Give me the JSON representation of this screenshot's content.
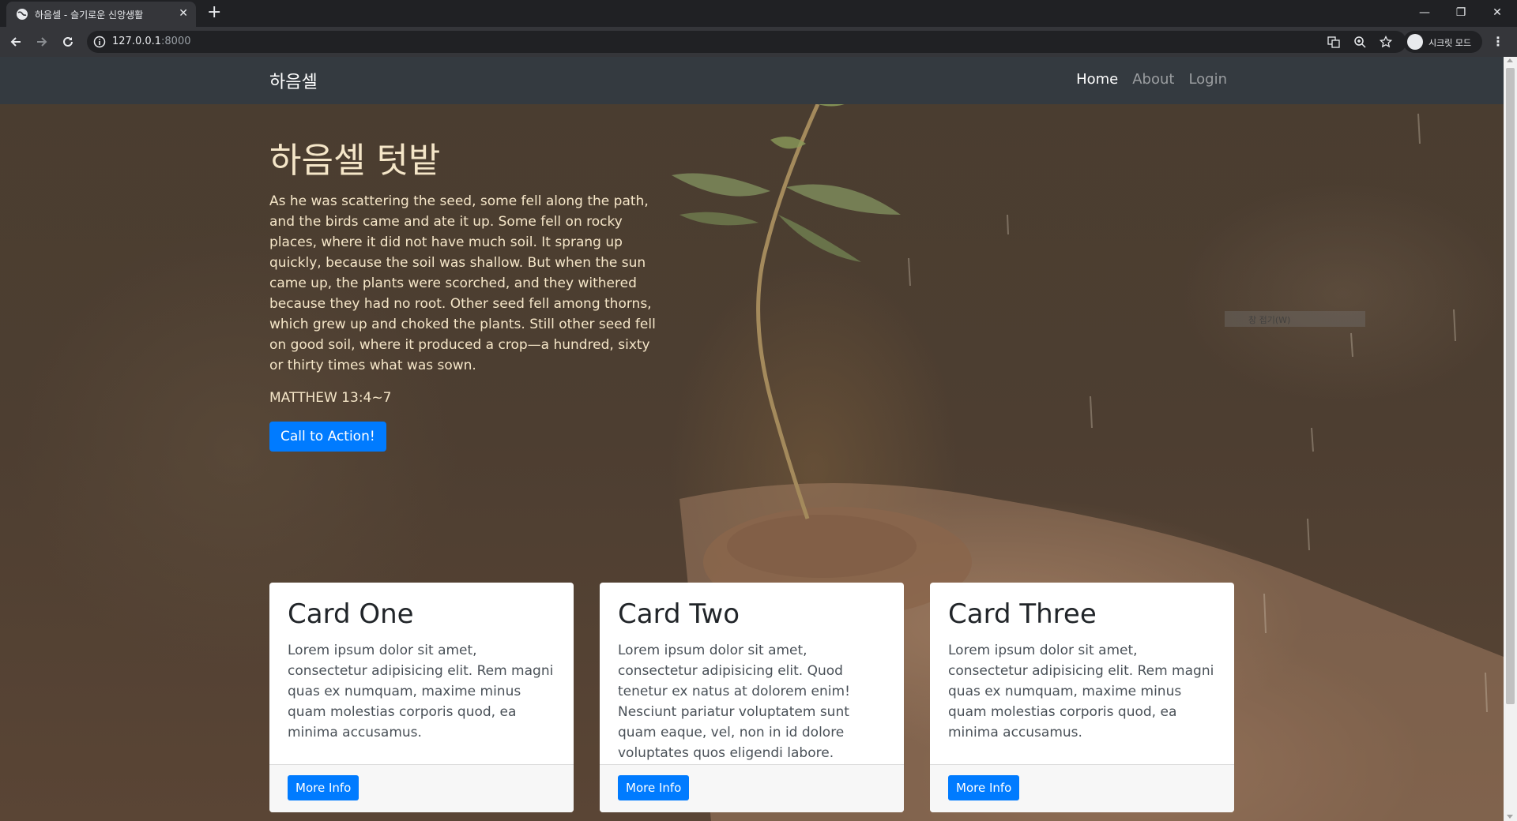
{
  "browser": {
    "tab_title": "하음셀 - 슬기로운 신앙생활",
    "url_host": "127.0.0.1",
    "url_port": ":8000",
    "incognito_label": "시크릿 모드"
  },
  "site": {
    "brand": "하음셀",
    "nav": [
      {
        "label": "Home"
      },
      {
        "label": "About"
      },
      {
        "label": "Login"
      }
    ]
  },
  "hero": {
    "title": "하음셀 텃밭",
    "text": "As he was scattering the seed, some fell along the path, and the birds came and ate it up. Some fell on rocky places, where it did not have much soil. It sprang up quickly, because the soil was shallow. But when the sun came up, the plants were scorched, and they withered because they had no root. Other seed fell among thorns, which grew up and choked the plants. Still other seed fell on good soil, where it produced a crop—a hundred, sixty or thirty times what was sown.",
    "reference": "MATTHEW 13:4~7",
    "cta_label": "Call to Action!"
  },
  "overlay_text": "창 접기(W)",
  "cards": [
    {
      "title": "Card One",
      "text": "Lorem ipsum dolor sit amet, consectetur adipisicing elit. Rem magni quas ex numquam, maxime minus quam molestias corporis quod, ea minima accusamus.",
      "button": "More Info"
    },
    {
      "title": "Card Two",
      "text": "Lorem ipsum dolor sit amet, consectetur adipisicing elit. Quod tenetur ex natus at dolorem enim! Nesciunt pariatur voluptatem sunt quam eaque, vel, non in id dolore voluptates quos eligendi labore.",
      "button": "More Info"
    },
    {
      "title": "Card Three",
      "text": "Lorem ipsum dolor sit amet, consectetur adipisicing elit. Rem magni quas ex numquam, maxime minus quam molestias corporis quod, ea minima accusamus.",
      "button": "More Info"
    }
  ],
  "colors": {
    "navbar": "#343a40",
    "primary": "#007bff",
    "hero_text": "#f5e6c8"
  }
}
